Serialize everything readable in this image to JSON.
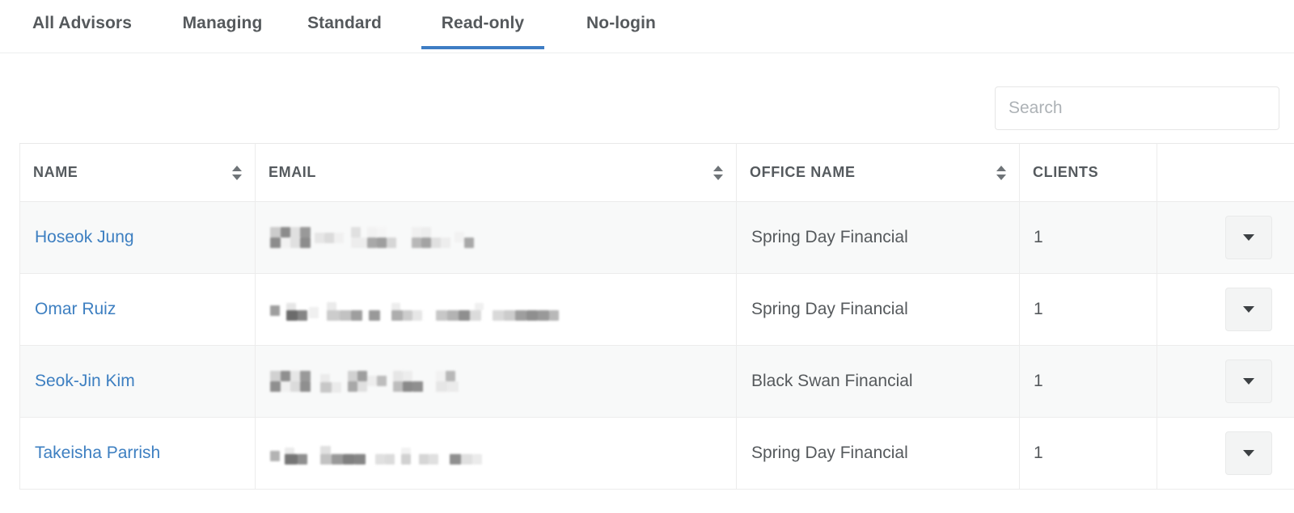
{
  "tabs": [
    {
      "label": "All Advisors",
      "active": false
    },
    {
      "label": "Managing",
      "active": false
    },
    {
      "label": "Standard",
      "active": false
    },
    {
      "label": "Read-only",
      "active": true
    },
    {
      "label": "No-login",
      "active": false
    }
  ],
  "search": {
    "placeholder": "Search",
    "value": ""
  },
  "table": {
    "columns": [
      {
        "label": "NAME",
        "sortable": true
      },
      {
        "label": "EMAIL",
        "sortable": true
      },
      {
        "label": "OFFICE NAME",
        "sortable": true
      },
      {
        "label": "CLIENTS",
        "sortable": false
      },
      {
        "label": "",
        "sortable": false
      }
    ],
    "rows": [
      {
        "name": "Hoseok Jung",
        "email": "",
        "email_redacted": true,
        "office_name": "Spring Day Financial",
        "clients": "1",
        "action": "row-menu"
      },
      {
        "name": "Omar Ruiz",
        "email": "",
        "email_redacted": true,
        "office_name": "Spring Day Financial",
        "clients": "1",
        "action": "row-menu"
      },
      {
        "name": "Seok-Jin Kim",
        "email": "",
        "email_redacted": true,
        "office_name": "Black Swan Financial",
        "clients": "1",
        "action": "row-menu"
      },
      {
        "name": "Takeisha Parrish",
        "email": "",
        "email_redacted": true,
        "office_name": "Spring Day Financial",
        "clients": "1",
        "action": "row-menu"
      }
    ]
  },
  "icons": {
    "sort": "sort-arrows-icon",
    "dropdown_caret": "chevron-down-icon"
  },
  "colors": {
    "accent": "#3e7dc4",
    "link": "#3d7fc1",
    "text": "#55595c",
    "header_text": "#555a5e",
    "row_stripe": "#f8f9f9",
    "border": "#ececec",
    "button_bg": "#f3f4f4"
  }
}
